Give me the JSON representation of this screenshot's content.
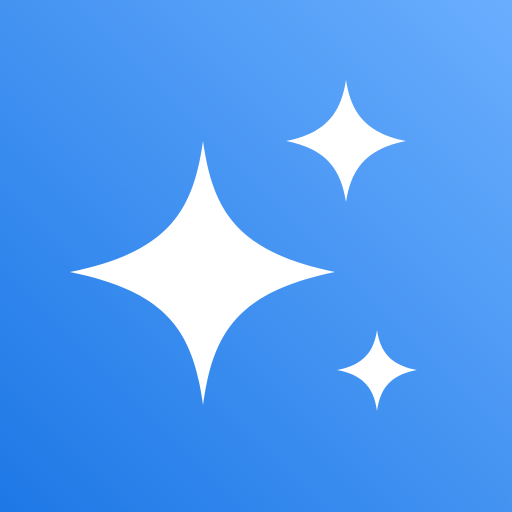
{
  "icon": {
    "name": "sparkles-icon",
    "colors": {
      "background_start": "#6aaefe",
      "background_end": "#1d78e6",
      "glyph": "#ffffff"
    }
  }
}
